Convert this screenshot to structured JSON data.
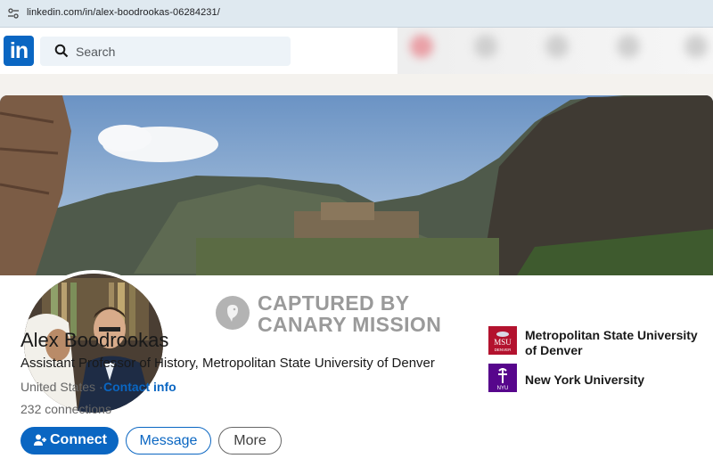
{
  "browser": {
    "url": "linkedin.com/in/alex-boodrookas-06284231/"
  },
  "header": {
    "logo_text": "in",
    "search_placeholder": "Search"
  },
  "watermark": {
    "line1": "CAPTURED BY",
    "line2": "CANARY MISSION"
  },
  "profile": {
    "name": "Alex Boodrookas",
    "headline": "Assistant Professor of History, Metropolitan State University of Denver",
    "location": "United States ·",
    "contact_label": "Contact info",
    "connections": "232 connections"
  },
  "actions": {
    "connect": "Connect",
    "message": "Message",
    "more": "More"
  },
  "education": [
    {
      "name_line1": "Metropolitan State University",
      "name_line2": "of Denver",
      "logo_text": "MSU",
      "logo_sub": "DENVER"
    },
    {
      "name_line1": "New York University",
      "logo_text": "NYU"
    }
  ],
  "colors": {
    "brand": "#0a66c2",
    "msu": "#b3122e",
    "nyu": "#57068c"
  }
}
